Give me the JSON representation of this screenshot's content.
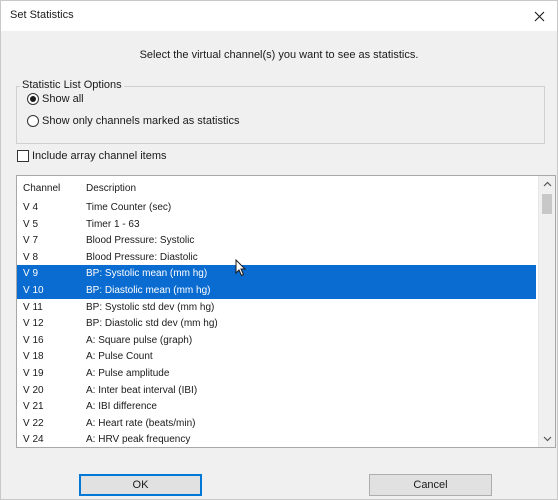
{
  "window": {
    "title": "Set Statistics"
  },
  "instruction": "Select the virtual channel(s) you want to see as statistics.",
  "options": {
    "group_label": "Statistic List Options",
    "show_all": "Show all",
    "show_marked": "Show only channels marked as statistics",
    "selected": "show_all"
  },
  "include_array": {
    "label": "Include array channel items",
    "checked": false
  },
  "list": {
    "columns": [
      "Channel",
      "Description"
    ],
    "rows": [
      {
        "channel": "V 4",
        "description": "Time Counter (sec)",
        "selected": false
      },
      {
        "channel": "V 5",
        "description": "Timer 1 - 63",
        "selected": false
      },
      {
        "channel": "V 7",
        "description": "Blood Pressure: Systolic",
        "selected": false
      },
      {
        "channel": "V 8",
        "description": "Blood Pressure: Diastolic",
        "selected": false
      },
      {
        "channel": "V 9",
        "description": "BP: Systolic mean (mm hg)",
        "selected": true
      },
      {
        "channel": "V 10",
        "description": "BP: Diastolic mean (mm hg)",
        "selected": true
      },
      {
        "channel": "V 11",
        "description": "BP: Systolic std dev (mm hg)",
        "selected": false
      },
      {
        "channel": "V 12",
        "description": "BP: Diastolic std dev (mm hg)",
        "selected": false
      },
      {
        "channel": "V 16",
        "description": "A: Square pulse (graph)",
        "selected": false
      },
      {
        "channel": "V 18",
        "description": "A: Pulse Count",
        "selected": false
      },
      {
        "channel": "V 19",
        "description": "A: Pulse amplitude",
        "selected": false
      },
      {
        "channel": "V 20",
        "description": "A: Inter beat interval (IBI)",
        "selected": false
      },
      {
        "channel": "V 21",
        "description": "A: IBI difference",
        "selected": false
      },
      {
        "channel": "V 22",
        "description": "A: Heart rate (beats/min)",
        "selected": false
      },
      {
        "channel": "V 24",
        "description": "A: HRV peak frequency",
        "selected": false
      }
    ]
  },
  "buttons": {
    "ok": "OK",
    "cancel": "Cancel"
  },
  "colors": {
    "selection": "#0a6bd0",
    "dialog_bg": "#f0f0f0",
    "default_button_border": "#0078d7"
  }
}
